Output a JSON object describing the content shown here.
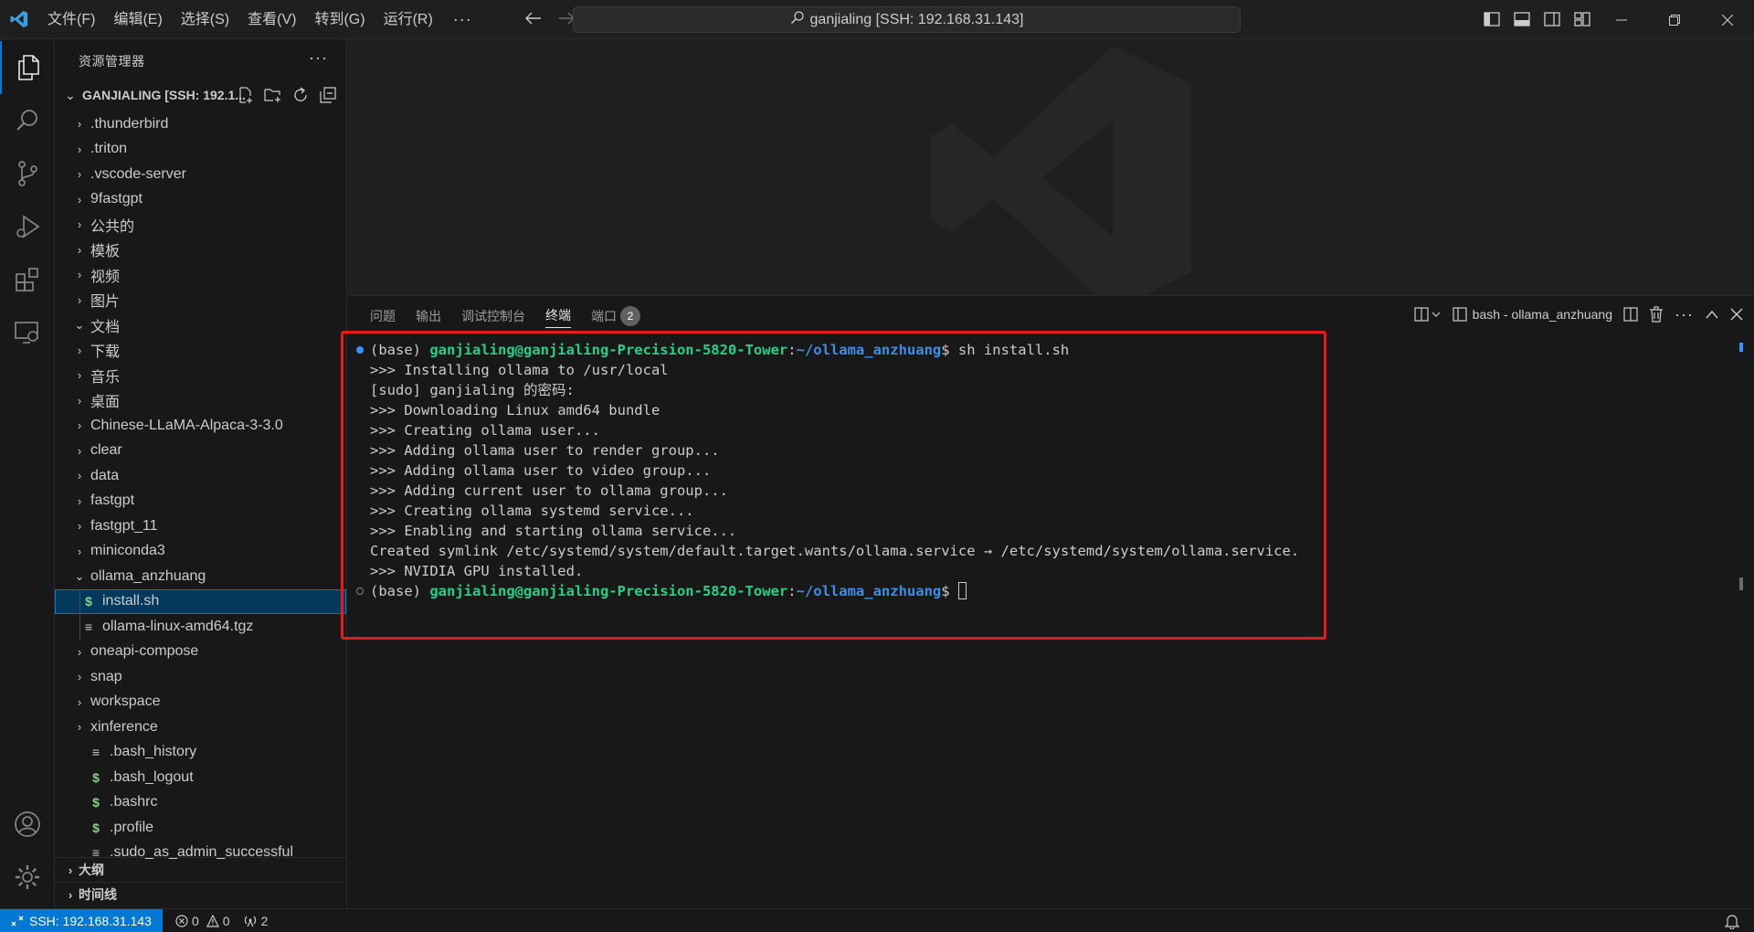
{
  "titlebar": {
    "menu": [
      "文件(F)",
      "编辑(E)",
      "选择(S)",
      "查看(V)",
      "转到(G)",
      "运行(R)"
    ],
    "more": "···",
    "command_center": "ganjialing [SSH: 192.168.31.143]"
  },
  "sidebar": {
    "title": "资源管理器",
    "more": "···",
    "root_label": "GANJIALING [SSH: 192.1...",
    "tree": [
      {
        "label": ".thunderbird",
        "twisty": "›",
        "icon": ""
      },
      {
        "label": ".triton",
        "twisty": "›",
        "icon": ""
      },
      {
        "label": ".vscode-server",
        "twisty": "›",
        "icon": ""
      },
      {
        "label": "9fastgpt",
        "twisty": "›",
        "icon": ""
      },
      {
        "label": "公共的",
        "twisty": "›",
        "icon": ""
      },
      {
        "label": "模板",
        "twisty": "›",
        "icon": ""
      },
      {
        "label": "视频",
        "twisty": "›",
        "icon": ""
      },
      {
        "label": "图片",
        "twisty": "›",
        "icon": ""
      },
      {
        "label": "文档",
        "twisty": "⌄",
        "icon": ""
      },
      {
        "label": "下载",
        "twisty": "›",
        "icon": ""
      },
      {
        "label": "音乐",
        "twisty": "›",
        "icon": ""
      },
      {
        "label": "桌面",
        "twisty": "›",
        "icon": ""
      },
      {
        "label": "Chinese-LLaMA-Alpaca-3-3.0",
        "twisty": "›",
        "icon": ""
      },
      {
        "label": "clear",
        "twisty": "›",
        "icon": ""
      },
      {
        "label": "data",
        "twisty": "›",
        "icon": ""
      },
      {
        "label": "fastgpt",
        "twisty": "›",
        "icon": ""
      },
      {
        "label": "fastgpt_11",
        "twisty": "›",
        "icon": ""
      },
      {
        "label": "miniconda3",
        "twisty": "›",
        "icon": ""
      },
      {
        "label": "ollama_anzhuang",
        "twisty": "⌄",
        "icon": ""
      },
      {
        "label": "install.sh",
        "twisty": "",
        "icon": "$",
        "child": true,
        "selected": true
      },
      {
        "label": "ollama-linux-amd64.tgz",
        "twisty": "",
        "icon": "≡",
        "child": true
      },
      {
        "label": "oneapi-compose",
        "twisty": "›",
        "icon": ""
      },
      {
        "label": "snap",
        "twisty": "›",
        "icon": ""
      },
      {
        "label": "workspace",
        "twisty": "›",
        "icon": ""
      },
      {
        "label": "xinference",
        "twisty": "›",
        "icon": ""
      },
      {
        "label": ".bash_history",
        "twisty": "",
        "icon": "≡"
      },
      {
        "label": ".bash_logout",
        "twisty": "",
        "icon": "$"
      },
      {
        "label": ".bashrc",
        "twisty": "",
        "icon": "$"
      },
      {
        "label": ".profile",
        "twisty": "",
        "icon": "$"
      },
      {
        "label": ".sudo_as_admin_successful",
        "twisty": "",
        "icon": "≡"
      }
    ],
    "sections": [
      "大纲",
      "时间线"
    ]
  },
  "panel": {
    "tabs": [
      "问题",
      "输出",
      "调试控制台",
      "终端",
      "端口"
    ],
    "ports_badge": "2",
    "terminal_name": "bash - ollama_anzhuang",
    "prompt_base": "(base) ",
    "prompt_user": "ganjialing@ganjialing-Precision-5820-Tower",
    "prompt_colon": ":",
    "prompt_path": "~/ollama_anzhuang",
    "prompt_dollar": "$ ",
    "command": "sh install.sh",
    "output": [
      ">>> Installing ollama to /usr/local",
      "[sudo] ganjialing 的密码:",
      ">>> Downloading Linux amd64 bundle",
      ">>> Creating ollama user...",
      ">>> Adding ollama user to render group...",
      ">>> Adding ollama user to video group...",
      ">>> Adding current user to ollama group...",
      ">>> Creating ollama systemd service...",
      ">>> Enabling and starting ollama service...",
      "Created symlink /etc/systemd/system/default.target.wants/ollama.service → /etc/systemd/system/ollama.service.",
      ">>> NVIDIA GPU installed."
    ]
  },
  "statusbar": {
    "remote": "SSH: 192.168.31.143",
    "errors": "0",
    "warnings": "0",
    "ports": "2"
  },
  "colors": {
    "accent": "#0078d4",
    "prompt_user": "#23d18b",
    "prompt_path": "#3b8eea",
    "highlight_box": "#e8191a"
  }
}
